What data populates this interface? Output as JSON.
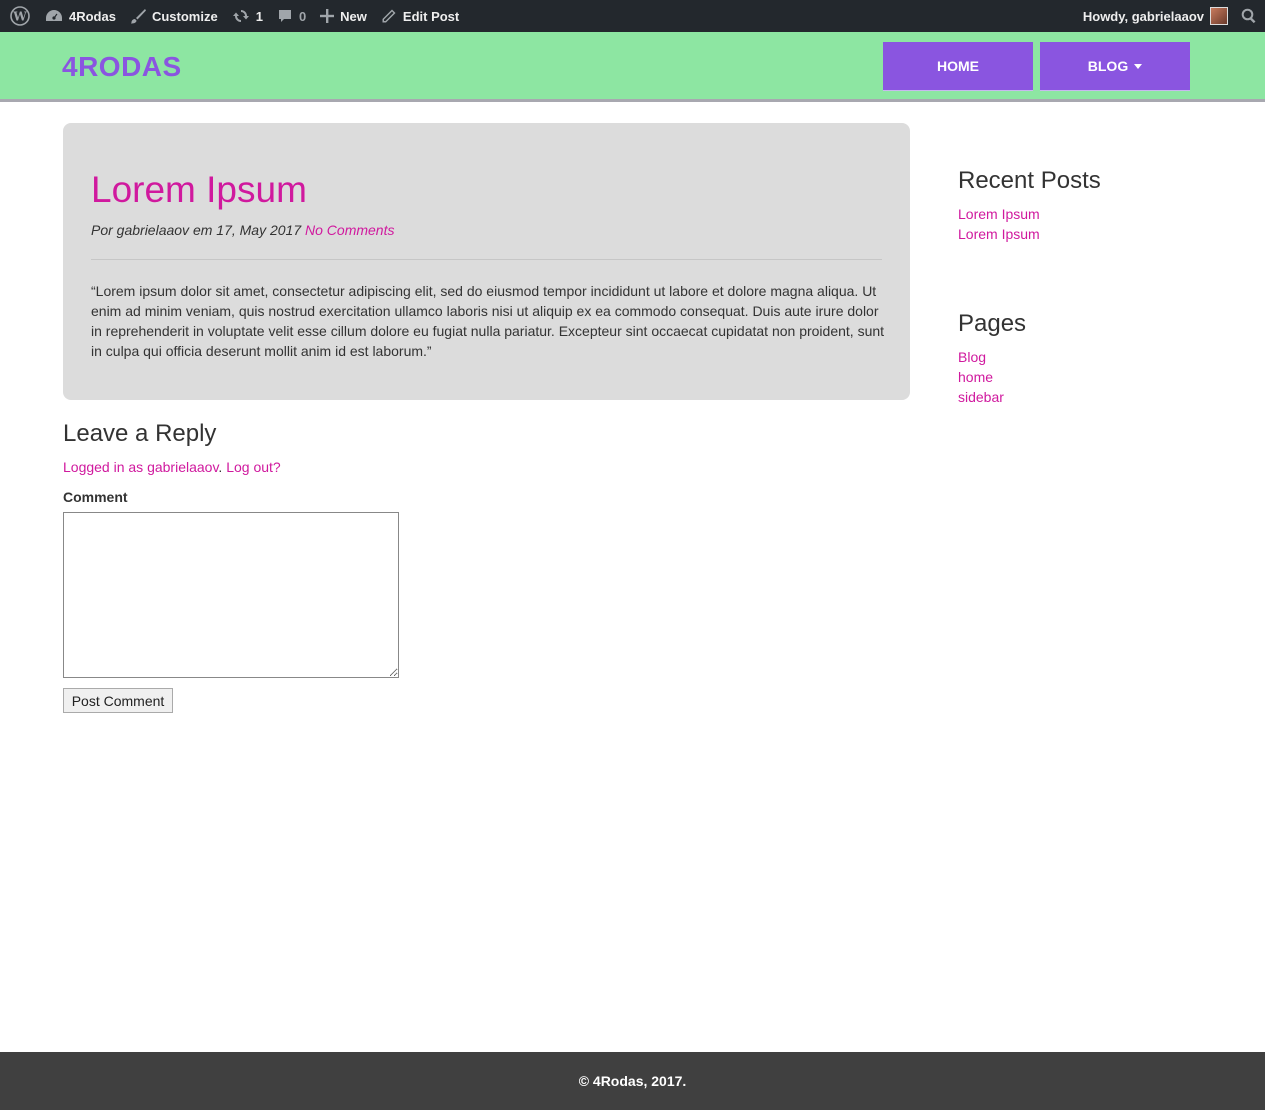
{
  "adminbar": {
    "site_name": "4Rodas",
    "customize": "Customize",
    "updates_count": "1",
    "comments_count": "0",
    "new": "New",
    "edit_post": "Edit Post",
    "howdy": "Howdy, gabrielaaov"
  },
  "header": {
    "logo": "4RODAS",
    "nav": {
      "home": "HOME",
      "blog": "BLOG"
    }
  },
  "post": {
    "title": "Lorem Ipsum",
    "meta": "Por gabrielaaov em 17, May 2017",
    "comments_link": "No Comments",
    "body": "“Lorem ipsum dolor sit amet, consectetur adipiscing elit, sed do eiusmod tempor incididunt ut labore et dolore magna aliqua. Ut enim ad minim veniam, quis nostrud exercitation ullamco laboris nisi ut aliquip ex ea commodo consequat. Duis aute irure dolor in reprehenderit in voluptate velit esse cillum dolore eu fugiat nulla pariatur. Excepteur sint occaecat cupidatat non proident, sunt in culpa qui officia deserunt mollit anim id est laborum.”"
  },
  "reply": {
    "title": "Leave a Reply",
    "logged_in": "Logged in as gabrielaaov",
    "separator": ".",
    "logout": "Log out?",
    "comment_label": "Comment",
    "comment_value": "",
    "submit": "Post Comment"
  },
  "sidebar": {
    "recent_title": "Recent Posts",
    "recent": [
      "Lorem Ipsum",
      "Lorem Ipsum"
    ],
    "pages_title": "Pages",
    "pages": [
      "Blog",
      "home",
      "sidebar"
    ]
  },
  "footer": {
    "text": "© 4Rodas, 2017."
  },
  "colors": {
    "header_bg": "#8de6a2",
    "brand_purple": "#8a55e0",
    "link_magenta": "#d0199e",
    "card_bg": "#dcdcdc",
    "adminbar_bg": "#23282d",
    "footer_bg": "#404040"
  },
  "icons": {
    "wordpress": "wordpress-icon",
    "dashboard": "dashboard-icon",
    "customize": "brush-icon",
    "updates": "refresh-icon",
    "comments": "comment-icon",
    "new": "plus-icon",
    "edit": "pencil-icon",
    "search": "search-icon",
    "dropdown": "chevron-down-icon"
  }
}
